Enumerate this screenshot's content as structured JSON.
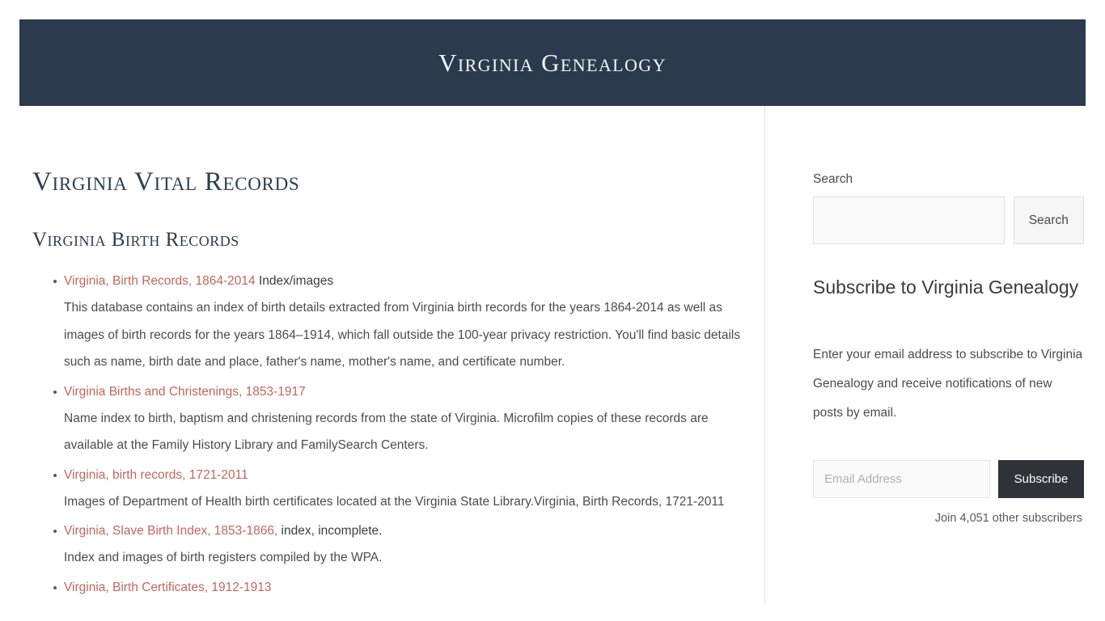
{
  "header": {
    "site_title": "Virginia Genealogy",
    "background_color": "#2b3a4c",
    "title_color": "#f4f6f8"
  },
  "main": {
    "page_title": "Virginia Vital Records",
    "section_title": "Virginia Birth Records",
    "link_color": "#c0675d",
    "records": [
      {
        "link_text": "Virginia, Birth Records, 1864-2014",
        "trailing_text": " Index/images",
        "description": "This database contains an index of birth details extracted from Virginia birth records for the years 1864-2014 as well as images of birth records for the years 1864–1914, which fall outside the 100-year privacy restriction. You'll find basic details such as name, birth date and place, father's name, mother's name, and certificate number."
      },
      {
        "link_text": "Virginia Births and Christenings, 1853-1917",
        "trailing_text": "",
        "description": "Name index to birth, baptism and christening records from the state of Virginia. Microfilm copies of these records are available at the Family History Library and FamilySearch Centers."
      },
      {
        "link_text": "Virginia, birth records, 1721-2011",
        "trailing_text": "",
        "description": "Images of Department of Health birth certificates located at the Virginia State Library.Virginia, Birth Records, 1721-2011"
      },
      {
        "link_text": "Virginia, Slave Birth Index, 1853-1866,",
        "trailing_text": " index, incomplete.",
        "description": "Index and images of birth registers compiled by the WPA."
      },
      {
        "link_text": "Virginia, Birth Certificates, 1912-1913",
        "trailing_text": "",
        "description": ""
      }
    ]
  },
  "sidebar": {
    "search": {
      "label": "Search",
      "input_value": "",
      "input_placeholder": "",
      "button_label": "Search"
    },
    "subscribe": {
      "title": "Subscribe to Virginia Genealogy",
      "description": "Enter your email address to subscribe to Virginia Genealogy and receive notifications of new posts by email.",
      "email_value": "",
      "email_placeholder": "Email Address",
      "button_label": "Subscribe",
      "button_color": "#2f3337",
      "subscriber_count_text": "Join 4,051 other subscribers"
    }
  }
}
